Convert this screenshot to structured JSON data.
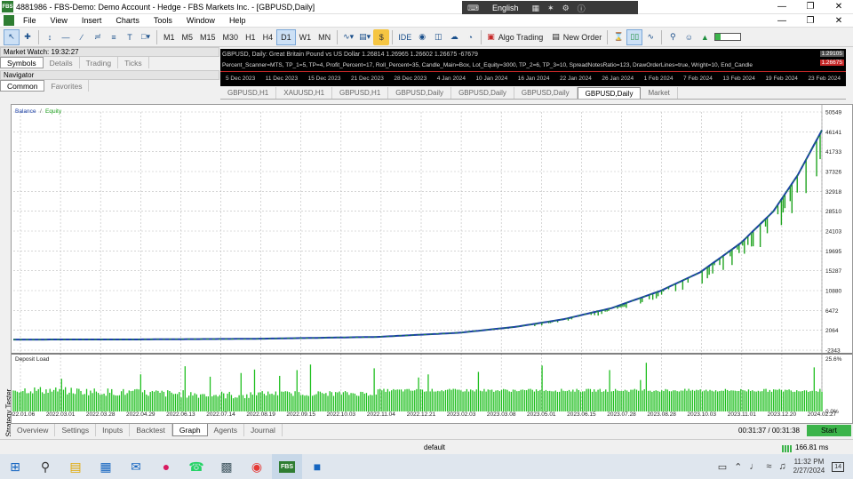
{
  "window": {
    "title": "4881986 - FBS-Demo: Demo Account - Hedge - FBS Markets Inc. - [GBPUSD,Daily]",
    "logo": "FBS",
    "lang": "English"
  },
  "menu": [
    "File",
    "View",
    "Insert",
    "Charts",
    "Tools",
    "Window",
    "Help"
  ],
  "toolbar": {
    "timeframes": [
      "M1",
      "M5",
      "M15",
      "M30",
      "H1",
      "H4",
      "D1",
      "W1",
      "MN"
    ],
    "selected_timeframe": "D1",
    "ide": "IDE",
    "algo_trading": "Algo Trading",
    "new_order": "New Order"
  },
  "market_watch": {
    "title": "Market Watch: 19:32:27",
    "tabs": [
      "Symbols",
      "Details",
      "Trading",
      "Ticks"
    ]
  },
  "navigator": {
    "title": "Navigator",
    "tabs": [
      "Common",
      "Favorites"
    ]
  },
  "mini_chart": {
    "header": "GBPUSD, Daily: Great Britain Pound vs US Dollar 1.26814 1.26965 1.26602 1.26675 -67679",
    "params": "Percent_Scanner=MTS, TP_1=5, TP=4, Profit_Percent=17, Roll_Percent=35, Candle_Main=Box, Lot_Equity=3000, TP_2=6, TP_3=10, SpreadNotesRatio=123, DrawOrderLines=true, Wright=10, End_Candle",
    "price_top": "1.29105",
    "price_bottom": "1.26675",
    "dates": [
      "5 Dec 2023",
      "11 Dec 2023",
      "15 Dec 2023",
      "21 Dec 2023",
      "28 Dec 2023",
      "4 Jan 2024",
      "10 Jan 2024",
      "16 Jan 2024",
      "22 Jan 2024",
      "26 Jan 2024",
      "1 Feb 2024",
      "7 Feb 2024",
      "13 Feb 2024",
      "19 Feb 2024",
      "23 Feb 2024"
    ]
  },
  "chart_tabs": [
    "GBPUSD,H1",
    "XAUUSD,H1",
    "GBPUSD,H1",
    "GBPUSD,Daily",
    "GBPUSD,Daily",
    "GBPUSD,Daily",
    "GBPUSD,Daily",
    "Market"
  ],
  "active_chart_tab": 6,
  "chart_data": {
    "type": "line",
    "legend": [
      "Balance",
      "Equity"
    ],
    "legend_sep": "/",
    "y_ticks": [
      -2343,
      2064,
      6472,
      10880,
      15287,
      19695,
      24103,
      28510,
      32918,
      37326,
      41733,
      46141,
      50549
    ],
    "ylim": [
      -2343,
      50549
    ],
    "x_ticks": [
      "2022.01.06",
      "2022.03.01",
      "2022.03.28",
      "2022.04.29",
      "2022.06.13",
      "2022.07.14",
      "2022.08.19",
      "2022.09.15",
      "2022.10.03",
      "2022.11.04",
      "2022.12.21",
      "2023.02.03",
      "2023.03.08",
      "2023.05.01",
      "2023.06.15",
      "2023.07.28",
      "2023.08.28",
      "2023.10.03",
      "2023.11.01",
      "2023.12.20",
      "2024.02.27"
    ],
    "balance_points": [
      [
        0,
        10
      ],
      [
        0.15,
        30
      ],
      [
        0.3,
        180
      ],
      [
        0.45,
        600
      ],
      [
        0.55,
        1500
      ],
      [
        0.62,
        2800
      ],
      [
        0.68,
        4500
      ],
      [
        0.74,
        7000
      ],
      [
        0.8,
        10800
      ],
      [
        0.85,
        15000
      ],
      [
        0.9,
        21500
      ],
      [
        0.94,
        28500
      ],
      [
        0.97,
        36500
      ],
      [
        1.0,
        46500
      ]
    ],
    "deposit_load": {
      "title": "Deposit Load",
      "y_max": "25.6%",
      "y_min": "0.0%"
    }
  },
  "bottom_tabs": [
    "Overview",
    "Settings",
    "Inputs",
    "Backtest",
    "Graph",
    "Agents",
    "Journal"
  ],
  "active_bottom_tab": "Graph",
  "strategy_tester": "Strategy Tester",
  "timer": "00:31:37 / 00:31:38",
  "start_label": "Start",
  "status": {
    "profile": "default",
    "network": "166.81 ms"
  },
  "taskbar": {
    "time": "11:32 PM",
    "date": "2/27/2024",
    "notif": "14"
  },
  "colors": {
    "balance": "#1a3fa6",
    "equity": "#1fa31f",
    "load": "#1fbf1f"
  }
}
